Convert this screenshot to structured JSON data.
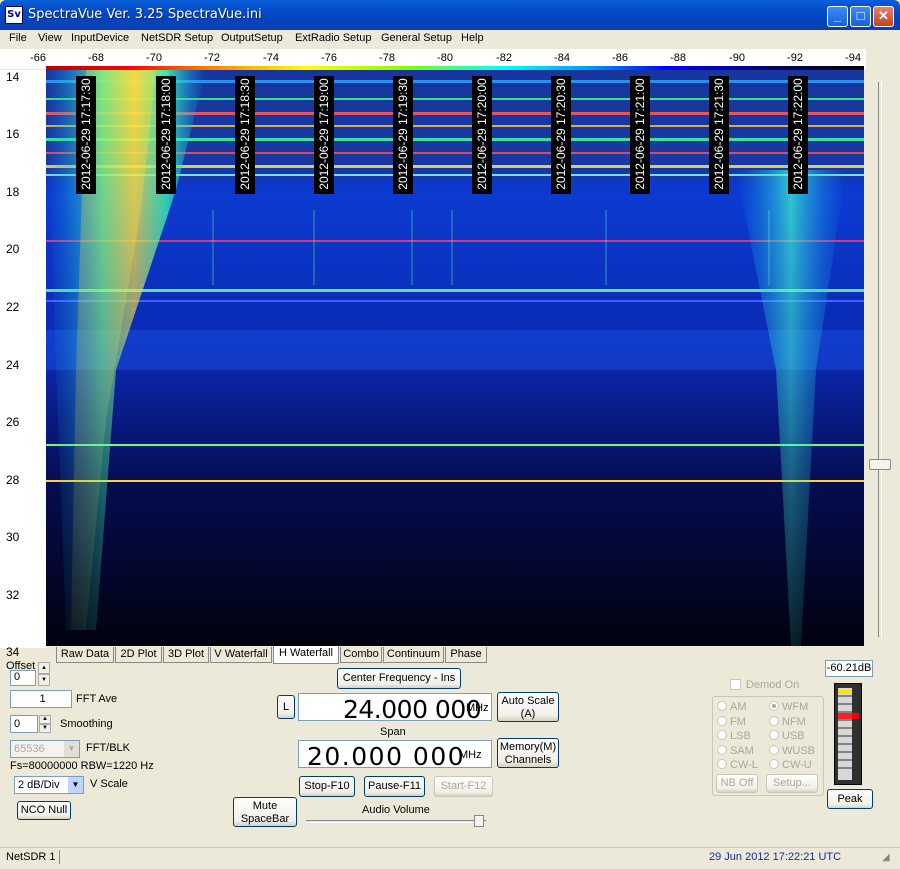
{
  "window": {
    "title": "SpectraVue Ver. 3.25  SpectraVue.ini",
    "icon_label": "Sv",
    "minimize": "_",
    "maximize": "□",
    "close": "✕"
  },
  "menu": [
    "File",
    "View",
    "InputDevice",
    "NetSDR Setup",
    "OutputSetup",
    "ExtRadio Setup",
    "General Setup",
    "Help"
  ],
  "colors": {
    "accent": "#0348c8",
    "waterfall_bg": "#000010"
  },
  "freq_scale": [
    "-66",
    "-68",
    "-70",
    "-72",
    "-74",
    "-76",
    "-78",
    "-80",
    "-82",
    "-84",
    "-86",
    "-88",
    "-90",
    "-92",
    "-94"
  ],
  "time_axis": [
    "14",
    "16",
    "18",
    "20",
    "22",
    "24",
    "26",
    "28",
    "30",
    "32",
    "34"
  ],
  "timestamps": [
    "2012-06-29 17:17:30",
    "2012-06-29 17:18:00",
    "2012-06-29 17:18:30",
    "2012-06-29 17:19:00",
    "2012-06-29 17:19:30",
    "2012-06-29 17:20:00",
    "2012-06-29 17:20:30",
    "2012-06-29 17:21:00",
    "2012-06-29 17:21:30",
    "2012-06-29 17:22:00"
  ],
  "tabs": [
    "Raw Data",
    "2D Plot",
    "3D Plot",
    "V Waterfall",
    "H Waterfall",
    "Combo",
    "Continuum",
    "Phase"
  ],
  "selected_tab": "H Waterfall",
  "offset": {
    "label": "Offset",
    "value": "0"
  },
  "fft_ave": {
    "value": "1",
    "label": "FFT Ave"
  },
  "smoothing": {
    "value": "0",
    "label": "Smoothing"
  },
  "fft_blk": {
    "value": "65536",
    "label": "FFT/BLK"
  },
  "fs_info": "Fs=80000000 RBW=1220 Hz",
  "vscale": {
    "value": "2 dB/Div",
    "label": "V Scale"
  },
  "nco_null": "NCO Null",
  "center_freq_button": "Center Frequency - Ins",
  "l_button": "L",
  "center_freq": {
    "value": "24.000 000",
    "unit": "MHz"
  },
  "span_label": "Span",
  "span": {
    "value": "20.000 000",
    "unit": "MHz"
  },
  "auto_scale": [
    "Auto Scale",
    "(A)"
  ],
  "memory": [
    "Memory(M)",
    "Channels"
  ],
  "stop": "Stop-F10",
  "pause": "Pause-F11",
  "start": "Start-F12",
  "mute": [
    "Mute",
    "SpaceBar"
  ],
  "audio_volume_label": "Audio Volume",
  "demod_on": "Demod On",
  "modes_left": [
    "AM",
    "FM",
    "LSB",
    "SAM",
    "CW-L"
  ],
  "modes_right": [
    "WFM",
    "NFM",
    "USB",
    "WUSB",
    "CW-U"
  ],
  "selected_mode": "WFM",
  "nb_off": "NB Off",
  "setup": "Setup...",
  "peak_value": "-60.21dB",
  "peak_button": "Peak",
  "status_left": "NetSDR 1",
  "status_right": "29 Jun 2012   17:22:21 UTC"
}
